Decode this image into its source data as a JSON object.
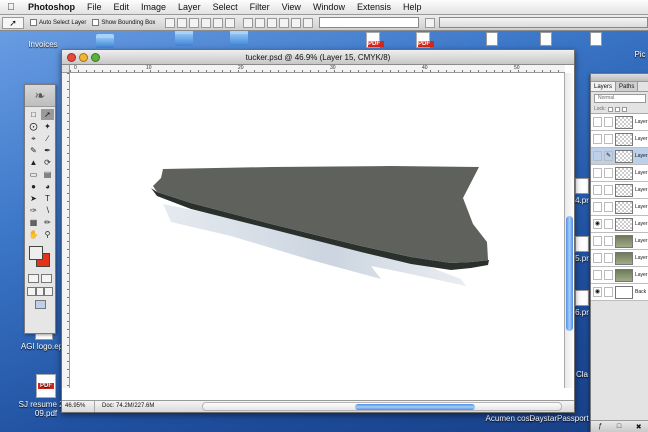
{
  "menubar": {
    "app_name": "Photoshop",
    "items": [
      "File",
      "Edit",
      "Image",
      "Layer",
      "Select",
      "Filter",
      "View",
      "Window",
      "Extensis",
      "Help"
    ]
  },
  "options_bar": {
    "auto_select_label": "Auto Select Layer",
    "bounding_box_label": "Show Bounding Box"
  },
  "desktop": {
    "items": [
      {
        "label": "Invoices",
        "icon": "folder"
      },
      {
        "label": "AGI logo.eps",
        "icon": "document"
      },
      {
        "label": "SJ resume 2-3-09.pdf",
        "icon": "pdf"
      },
      {
        "label": "4.pr",
        "icon": "document"
      },
      {
        "label": "5.pr",
        "icon": "document"
      },
      {
        "label": "6.pr",
        "icon": "document"
      },
      {
        "label": "Acumen cost-",
        "icon": "document"
      },
      {
        "label": "DaystarPassport",
        "icon": "document"
      },
      {
        "label": "Pic",
        "icon": "document"
      },
      {
        "label": "Cla",
        "icon": "document"
      }
    ]
  },
  "document": {
    "title": "tucker.psd @ 46.9% (Layer 15, CMYK/8)",
    "zoom": "46.95%",
    "doc_info": "Doc: 74.2M/227.6M",
    "ruler_labels": [
      "0",
      "10",
      "20",
      "30",
      "40",
      "50"
    ]
  },
  "layers_panel": {
    "tabs": [
      "Layers",
      "Paths"
    ],
    "blend_mode": "Normal",
    "lock_label": "Lock:",
    "layers": [
      {
        "name": "Layer",
        "thumb": "transparent",
        "visible": false,
        "selected": false,
        "linked": false
      },
      {
        "name": "Layer",
        "thumb": "transparent",
        "visible": false,
        "selected": false,
        "linked": false
      },
      {
        "name": "Layer",
        "thumb": "transparent",
        "visible": false,
        "selected": true,
        "linked": true
      },
      {
        "name": "Layer",
        "thumb": "transparent",
        "visible": false,
        "selected": false,
        "linked": false
      },
      {
        "name": "Layer",
        "thumb": "transparent",
        "visible": false,
        "selected": false,
        "linked": false
      },
      {
        "name": "Layer",
        "thumb": "transparent",
        "visible": false,
        "selected": false,
        "linked": false
      },
      {
        "name": "Layer",
        "thumb": "transparent",
        "visible": true,
        "selected": false,
        "linked": false
      },
      {
        "name": "Layer",
        "thumb": "image",
        "visible": false,
        "selected": false,
        "linked": false
      },
      {
        "name": "Layer",
        "thumb": "image",
        "visible": false,
        "selected": false,
        "linked": false
      },
      {
        "name": "Layer",
        "thumb": "image",
        "visible": false,
        "selected": false,
        "linked": false
      },
      {
        "name": "Back",
        "thumb": "white",
        "visible": true,
        "selected": false,
        "linked": false
      }
    ]
  },
  "colors": {
    "foreground": "#eeeeee",
    "background": "#e53318",
    "shape_top": "#5e615c",
    "shape_edge": "#2a302b"
  }
}
